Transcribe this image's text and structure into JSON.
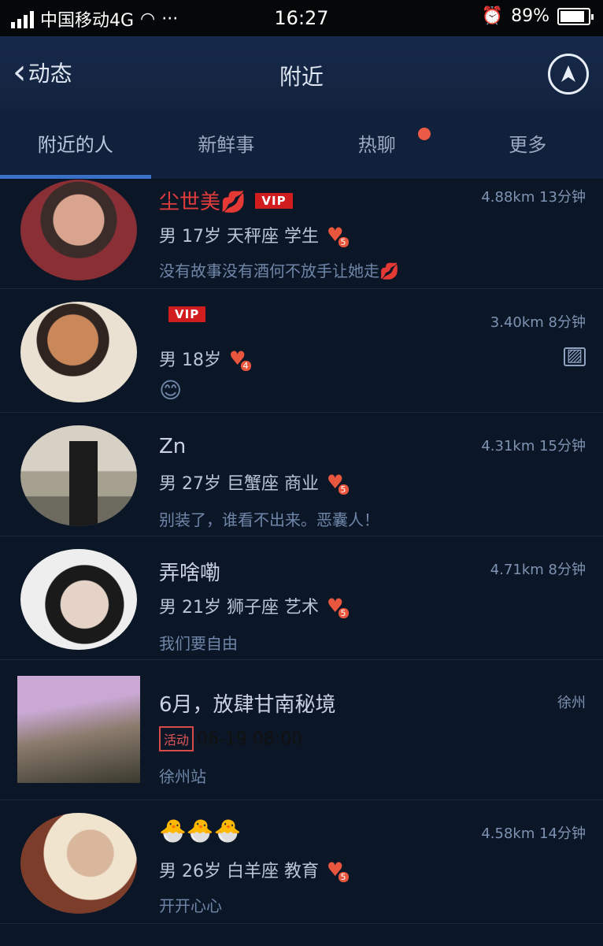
{
  "status": {
    "carrier": "中国移动4G",
    "time": "16:27",
    "battery": "89%",
    "battery_level": 0.89
  },
  "nav": {
    "back_label": "动态",
    "title": "附近",
    "compass_icon": "navigation-icon"
  },
  "tabs": [
    {
      "label": "附近的人",
      "active": true
    },
    {
      "label": "新鲜事"
    },
    {
      "label": "热聊",
      "badge": true
    },
    {
      "label": "更多"
    }
  ],
  "people": [
    {
      "name": "尘世美💋",
      "vip": "VIP",
      "distance": "4.88km",
      "time": "13分钟",
      "info": "男 17岁 天秤座 学生",
      "level": "5",
      "signature": "没有故事没有酒何不放手让她走💋"
    },
    {
      "name": "",
      "vip": "VIP",
      "distance": "3.40km",
      "time": "8分钟",
      "info": "男 18岁",
      "level": "4",
      "signature": "😊"
    },
    {
      "name": "Zn",
      "distance": "4.31km",
      "time": "15分钟",
      "info": "男 27岁 巨蟹座 商业",
      "level": "5",
      "signature": "别装了，谁看不出来。恶囊人！"
    },
    {
      "name": "弄啥嘞",
      "distance": "4.71km",
      "time": "8分钟",
      "info": "男 21岁 狮子座 艺术",
      "level": "5",
      "signature": "我们要自由"
    }
  ],
  "event": {
    "title": "6月，放肆甘南秘境",
    "city": "徐州",
    "tag": "活动",
    "datetime": "06-19 08:00",
    "station": "徐州站"
  },
  "person5": {
    "name": "🐣🐣🐣",
    "distance": "4.58km",
    "time": "14分钟",
    "info": "男 26岁 白羊座 教育",
    "level": "5",
    "signature": "开开心心"
  }
}
